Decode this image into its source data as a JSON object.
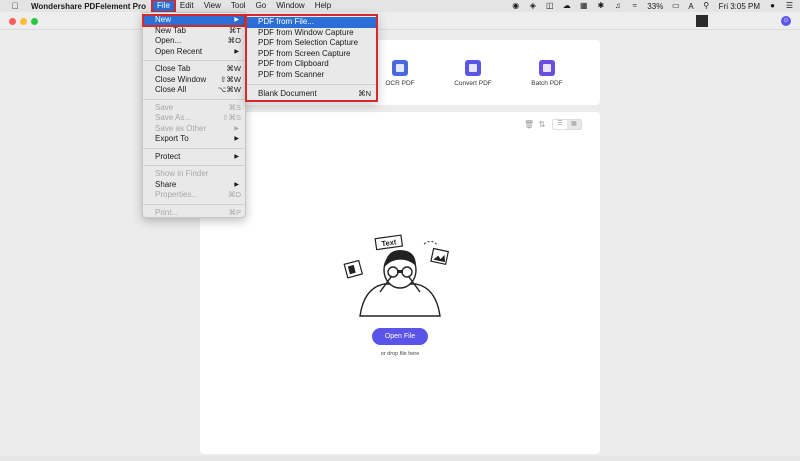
{
  "menubar": {
    "app_name": "Wondershare PDFelement Pro",
    "items": [
      "File",
      "Edit",
      "View",
      "Tool",
      "Go",
      "Window",
      "Help"
    ],
    "status": {
      "battery": "33%",
      "input_source": "A",
      "time": "Fri 3:05 PM"
    }
  },
  "tools": [
    {
      "label": "OCR PDF",
      "color": "#4a68e0"
    },
    {
      "label": "Convert PDF",
      "color": "#5b54e8"
    },
    {
      "label": "Batch PDF",
      "color": "#6a4fe0"
    }
  ],
  "dropzone": {
    "illustration_text": "Text",
    "open_button": "Open File",
    "hint": "or drop file here"
  },
  "file_menu": {
    "new": {
      "label": "New"
    },
    "new_tab": {
      "label": "New Tab",
      "shortcut": "⌘T"
    },
    "open": {
      "label": "Open...",
      "shortcut": "⌘O"
    },
    "open_recent": {
      "label": "Open Recent"
    },
    "close_tab": {
      "label": "Close Tab",
      "shortcut": "⌘W"
    },
    "close_window": {
      "label": "Close Window",
      "shortcut": "⇧⌘W"
    },
    "close_all": {
      "label": "Close All",
      "shortcut": "⌥⌘W"
    },
    "save": {
      "label": "Save",
      "shortcut": "⌘S"
    },
    "save_as": {
      "label": "Save As...",
      "shortcut": "⇧⌘S"
    },
    "save_as_other": {
      "label": "Save as Other"
    },
    "export_to": {
      "label": "Export To"
    },
    "protect": {
      "label": "Protect"
    },
    "show_in_finder": {
      "label": "Show in Finder"
    },
    "share": {
      "label": "Share"
    },
    "properties": {
      "label": "Properties...",
      "shortcut": "⌘D"
    },
    "print": {
      "label": "Print...",
      "shortcut": "⌘P"
    }
  },
  "new_submenu": {
    "items": [
      "PDF from File...",
      "PDF from Window Capture",
      "PDF from Selection Capture",
      "PDF from Screen Capture",
      "PDF from Clipboard",
      "PDF from Scanner"
    ],
    "blank": {
      "label": "Blank Document",
      "shortcut": "⌘N"
    }
  },
  "colors": {
    "accent": "#2b6fd6",
    "annotation": "#d42a2a",
    "primary_button": "#5b54e8"
  }
}
